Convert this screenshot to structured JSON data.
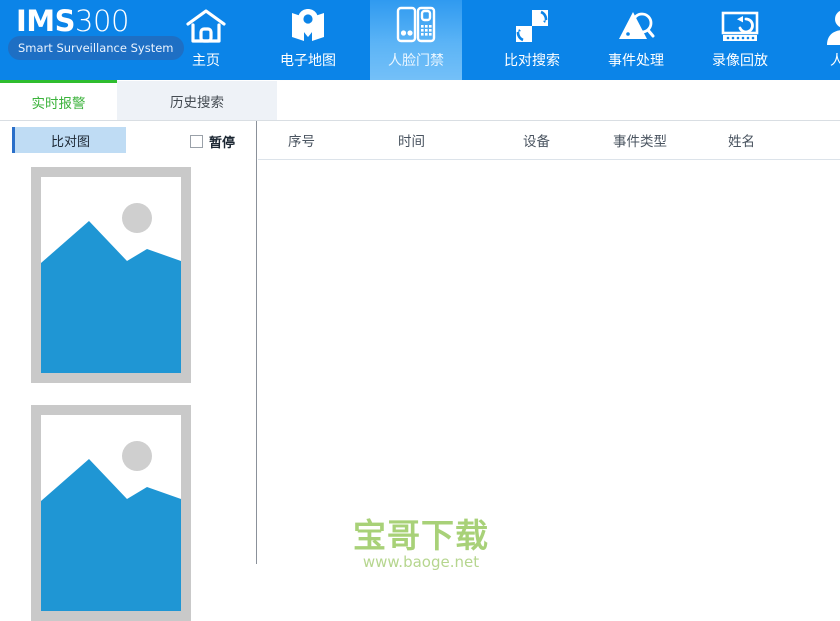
{
  "brand": {
    "name_bold": "IMS",
    "name_thin": "300",
    "tagline": "Smart Surveillance System"
  },
  "nav": {
    "items": [
      {
        "label": "主页",
        "icon": "home-icon",
        "active": false
      },
      {
        "label": "电子地图",
        "icon": "map-pin-icon",
        "active": false
      },
      {
        "label": "人脸门禁",
        "icon": "door-access-icon",
        "active": true
      },
      {
        "label": "比对搜索",
        "icon": "compare-search-icon",
        "active": false
      },
      {
        "label": "事件处理",
        "icon": "event-alarm-icon",
        "active": false
      },
      {
        "label": "录像回放",
        "icon": "playback-icon",
        "active": false
      },
      {
        "label": "人脸",
        "icon": "face-icon",
        "active": false
      }
    ]
  },
  "tabs": [
    {
      "label": "实时报警",
      "active": true
    },
    {
      "label": "历史搜索",
      "active": false
    }
  ],
  "left_panel": {
    "tag_label": "比对图",
    "pause_label": "暂停",
    "pause_checked": false,
    "thumbnails": [
      {
        "alt": "broken-image-placeholder"
      },
      {
        "alt": "broken-image-placeholder"
      }
    ]
  },
  "table": {
    "columns": [
      "序号",
      "时间",
      "设备",
      "事件类型",
      "姓名"
    ],
    "rows": []
  },
  "watermark": {
    "main": "宝哥下载",
    "sub": "www.baoge.net"
  },
  "colors": {
    "nav_blue": "#0b84e8",
    "nav_active": "#5cb4f6",
    "tab_green": "#3cb33c",
    "panel_tag": "#bfdcf4",
    "placeholder_blue": "#1f96d4",
    "placeholder_grey": "#c9c9c9",
    "watermark_green": "#a8d178"
  }
}
